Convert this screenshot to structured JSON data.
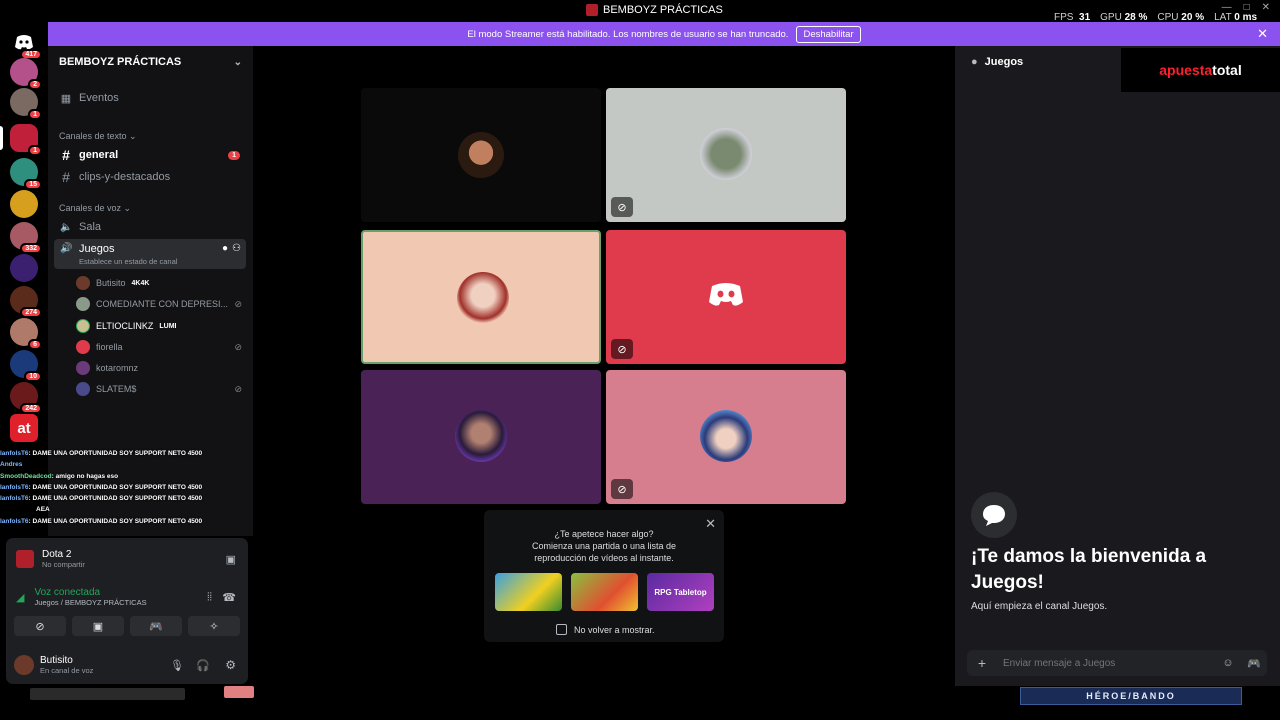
{
  "titlebar": {
    "title": "BEMBOYZ PRÁCTICAS",
    "fps_label": "FPS",
    "fps_value": "31",
    "gpu_label": "GPU",
    "gpu_value": "28 %",
    "cpu_label": "CPU",
    "cpu_value": "20 %",
    "lat_label": "LAT",
    "lat_value": "0 ms"
  },
  "banner": {
    "text": "El modo Streamer está habilitado. Los nombres de usuario se han truncado.",
    "button": "Deshabilitar"
  },
  "rail": {
    "badges": [
      "417",
      "2",
      "1",
      "1",
      "15",
      "332",
      "274",
      "6",
      "10",
      "242"
    ]
  },
  "sidebar": {
    "server_name": "BEMBOYZ PRÁCTICAS",
    "events": "Eventos",
    "text_category": "Canales de texto",
    "voice_category": "Canales de voz",
    "channels": [
      {
        "name": "general",
        "badge": "1"
      },
      {
        "name": "clips-y-destacados"
      }
    ],
    "voice_channels": [
      {
        "name": "Sala"
      },
      {
        "name": "Juegos",
        "status": "Establece un estado de canal"
      }
    ],
    "members": [
      {
        "name": "Butisito",
        "tag": "4K4K"
      },
      {
        "name": "COMEDIANTE CON DEPRESI..."
      },
      {
        "name": "ELTIOCLINKZ",
        "tag": "LUMI"
      },
      {
        "name": "fiorella"
      },
      {
        "name": "kotaromnz"
      },
      {
        "name": "SLATEM$"
      }
    ]
  },
  "overlay": {
    "lines": [
      {
        "name": "lanfolsT6",
        "msg": ": DAME UNA OPORTUNIDAD SOY SUPPORT NETO 4500"
      },
      {
        "name": "Andres",
        "msg": ""
      },
      {
        "name": "SmoothDeadcod",
        "msg": ": amigo no hagas eso"
      },
      {
        "name": "lanfolsT6",
        "msg": ": DAME UNA OPORTUNIDAD SOY SUPPORT NETO 4500"
      },
      {
        "name": "lanfolsT6",
        "msg": ": DAME UNA OPORTUNIDAD SOY SUPPORT NETO 4500"
      },
      {
        "name": "",
        "msg": "AEA"
      },
      {
        "name": "lanfolsT6",
        "msg": ": DAME UNA OPORTUNIDAD SOY SUPPORT NETO 4500"
      }
    ]
  },
  "userpanel": {
    "game": "Dota 2",
    "game_sub": "No compartir",
    "voice_status": "Voz conectada",
    "voice_location": "Juegos / BEMBOYZ PRÁCTICAS",
    "username": "Butisito",
    "user_status": "En canal de voz"
  },
  "activity": {
    "line1": "¿Te apetece hacer algo?",
    "line2": "Comienza una partida o una lista de",
    "line3": "reproducción de vídeos al instante.",
    "card3": "RPG Tabletop",
    "checkbox": "No volver a mostrar."
  },
  "rightpanel": {
    "channel": "Juegos",
    "welcome_title": "¡Te damos la bienvenida a Juegos!",
    "welcome_sub": "Aquí empieza el canal Juegos.",
    "placeholder": "Enviar mensaje a Juegos"
  },
  "ad": {
    "left": "apuesta",
    "right": "total"
  },
  "bottom": {
    "banner": "HÉROE/BANDO"
  },
  "colors": {
    "accent": "#8c52f0",
    "discord_red": "#e03b4c",
    "voice_green": "#23a55a",
    "badge_red": "#ed4245"
  }
}
